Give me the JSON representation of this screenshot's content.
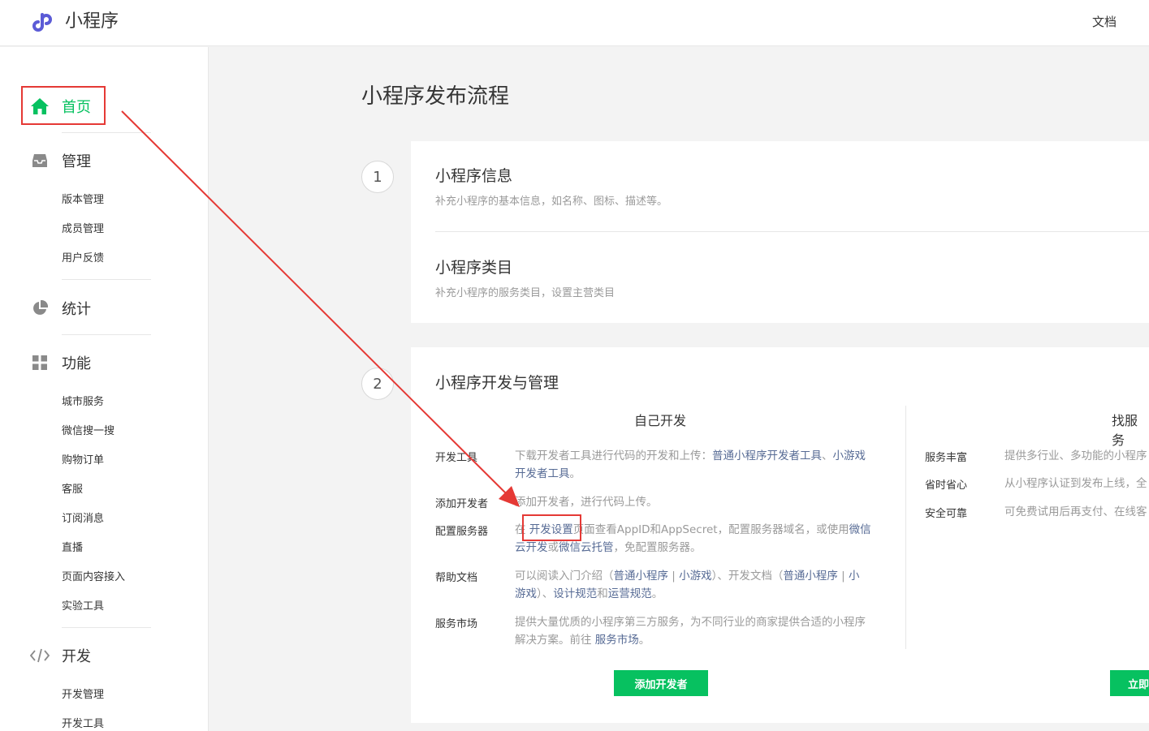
{
  "header": {
    "brand": "小程序",
    "doc_link": "文档"
  },
  "sidebar": {
    "home": "首页",
    "manage": {
      "label": "管理",
      "items": [
        "版本管理",
        "成员管理",
        "用户反馈"
      ]
    },
    "stats": {
      "label": "统计"
    },
    "features": {
      "label": "功能",
      "items": [
        "城市服务",
        "微信搜一搜",
        "购物订单",
        "客服",
        "订阅消息",
        "直播",
        "页面内容接入",
        "实验工具"
      ]
    },
    "dev": {
      "label": "开发",
      "items": [
        "开发管理",
        "开发工具"
      ]
    }
  },
  "main": {
    "title": "小程序发布流程",
    "step1": {
      "number": "1",
      "info_title": "小程序信息",
      "info_desc": "补充小程序的基本信息，如名称、图标、描述等。",
      "category_title": "小程序类目",
      "category_desc": "补充小程序的服务类目，设置主营类目"
    },
    "step2": {
      "number": "2",
      "title": "小程序开发与管理",
      "self_dev": {
        "heading": "自己开发",
        "rows": {
          "tools": {
            "label": "开发工具",
            "t1": "下载开发者工具进行代码的开发和上传：",
            "l1": "普通小程序开发者工具",
            "t2": "、",
            "l2": "小游戏",
            "l3": "开发者工具",
            "t3": "。"
          },
          "add_dev": {
            "label": "添加开发者",
            "text": "添加开发者，进行代码上传。"
          },
          "server": {
            "label": "配置服务器",
            "t1": "在",
            "l1": "开发设置",
            "t2": "页面查看AppID和AppSecret，配置服务器域名，或使用",
            "l2": "微信",
            "l3": "云开发",
            "t3": "或",
            "l4": "微信云托管",
            "t4": "，免配置服务器。"
          },
          "help": {
            "label": "帮助文档",
            "t1": "可以阅读入门介绍（",
            "l1": "普通小程序",
            "t2": " | ",
            "l2": "小游戏",
            "t3": "）、开发文档（",
            "l3": "普通小程序",
            "t4": " | ",
            "l4": "小",
            "l5": "游戏",
            "t5": "）、",
            "l6": "设计规范",
            "t6": "和",
            "l7": "运营规范",
            "t7": "。"
          },
          "market": {
            "label": "服务市场",
            "t1": "提供大量优质的小程序第三方服务，为不同行业的商家提供合适的小程序",
            "t2": "解决方案。前往",
            "l1": "服务市场",
            "t3": "。"
          }
        },
        "button": "添加开发者"
      },
      "find_service": {
        "heading": "找服务",
        "rows": {
          "rich": {
            "label": "服务丰富",
            "text": "提供多行业、多功能的小程序"
          },
          "save": {
            "label": "省时省心",
            "text": "从小程序认证到发布上线，全"
          },
          "safe": {
            "label": "安全可靠",
            "text": "可免费试用后再支付、在线客"
          }
        },
        "button": "立即"
      }
    }
  },
  "colors": {
    "accent": "#07c160",
    "link": "#576b95",
    "annotation": "#e53935"
  }
}
